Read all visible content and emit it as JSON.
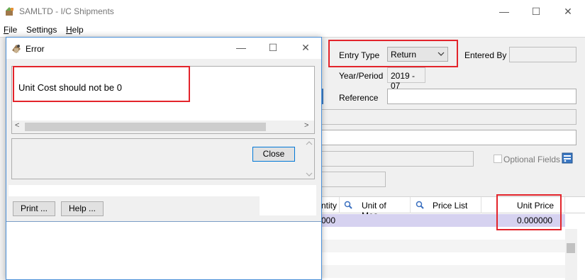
{
  "window": {
    "title": "SAMLTD - I/C Shipments",
    "minimize_glyph": "—",
    "maximize_glyph": "☐",
    "close_glyph": "✕"
  },
  "menu": [
    {
      "label": "File",
      "underline": "F",
      "rest": "ile"
    },
    {
      "label": "Settings",
      "underline": "",
      "rest": "Settings"
    },
    {
      "label": "Help",
      "underline": "H",
      "rest": "elp"
    }
  ],
  "form": {
    "entry_type_label": "Entry Type",
    "entry_type_value": "Return",
    "entered_by_label": "Entered By",
    "year_period_label": "Year/Period",
    "year_period_value": "2019 - 07",
    "reference_label": "Reference",
    "optional_fields_label": "Optional Fields"
  },
  "grid": {
    "columns": [
      "ntity",
      "Unit of Mea...",
      "Price List",
      "Unit Price"
    ],
    "row_values": {
      "quantity": "000",
      "unit_price": "0.000000"
    }
  },
  "dialog": {
    "title": "Error",
    "message": "Unit Cost should not be 0",
    "close_label": "Close",
    "print_label": "Print ...",
    "help_label": "Help ...",
    "scroll_left_glyph": "<",
    "scroll_right_glyph": ">"
  },
  "colors": {
    "highlight_border": "#e3242b",
    "selected_row": "#d6d2f0",
    "focus_border": "#0078d7"
  },
  "icons": [
    "app-icon",
    "error-dialog-icon",
    "search-icon",
    "optional-fields-icon",
    "chevron-down-icon"
  ]
}
